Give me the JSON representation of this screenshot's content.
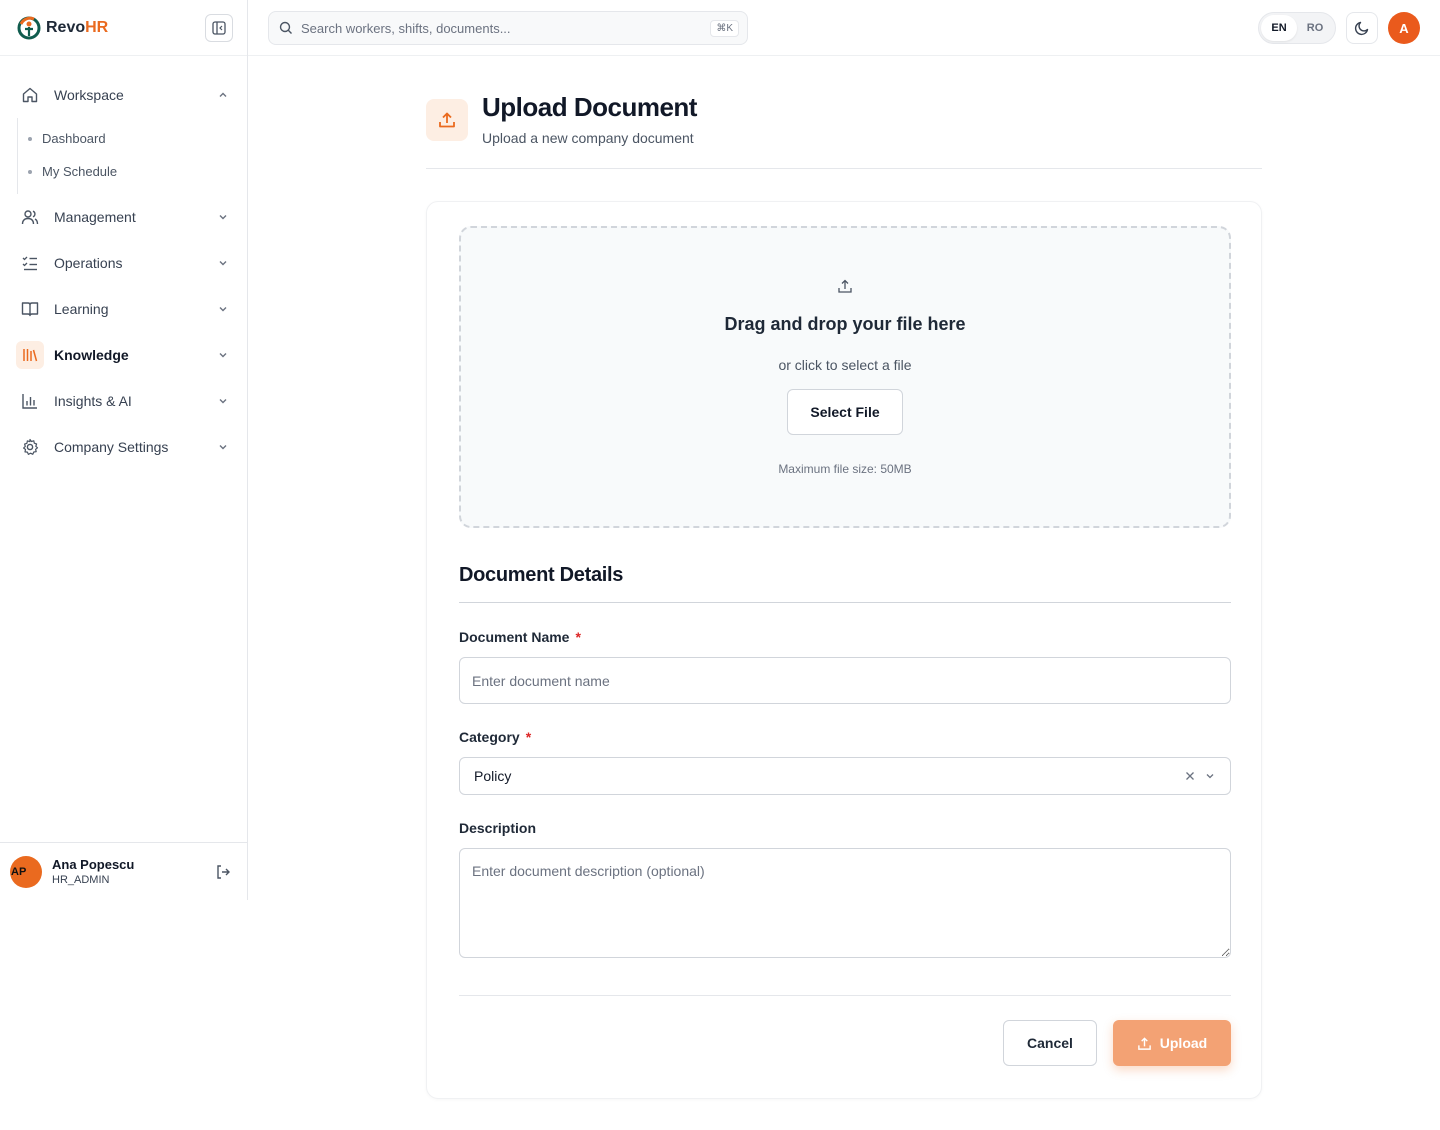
{
  "brand": {
    "name_part1": "Revo",
    "name_part2": "HR",
    "accent": "#ea6a1f"
  },
  "search": {
    "placeholder": "Search workers, shifts, documents...",
    "shortcut": "⌘K"
  },
  "lang": {
    "options": [
      "EN",
      "RO"
    ],
    "selected": "EN"
  },
  "topbar": {
    "avatar_initial": "A",
    "theme_icon": "moon-icon"
  },
  "sidebar": {
    "workspace": {
      "label": "Workspace",
      "icon": "home-icon",
      "expanded": true,
      "children": [
        "Dashboard",
        "My Schedule"
      ]
    },
    "items": [
      {
        "label": "Management",
        "icon": "users-icon"
      },
      {
        "label": "Operations",
        "icon": "checklist-icon"
      },
      {
        "label": "Learning",
        "icon": "book-open-icon"
      },
      {
        "label": "Knowledge",
        "icon": "library-icon",
        "active": true
      },
      {
        "label": "Insights & AI",
        "icon": "bar-chart-icon"
      },
      {
        "label": "Company Settings",
        "icon": "gear-icon"
      }
    ],
    "user": {
      "initials": "AP",
      "name": "Ana Popescu",
      "role": "HR_ADMIN"
    }
  },
  "page": {
    "title": "Upload Document",
    "subtitle": "Upload a new company document"
  },
  "dropzone": {
    "title": "Drag and drop your file here",
    "subtitle": "or click to select a file",
    "button": "Select File",
    "max_size": "Maximum file size: 50MB"
  },
  "details": {
    "section_title": "Document Details",
    "name_label": "Document Name",
    "name_placeholder": "Enter document name",
    "category_label": "Category",
    "category_value": "Policy",
    "description_label": "Description",
    "description_placeholder": "Enter document description (optional)",
    "required_mark": "*"
  },
  "actions": {
    "cancel": "Cancel",
    "upload": "Upload",
    "upload_color": "#f3a274"
  }
}
